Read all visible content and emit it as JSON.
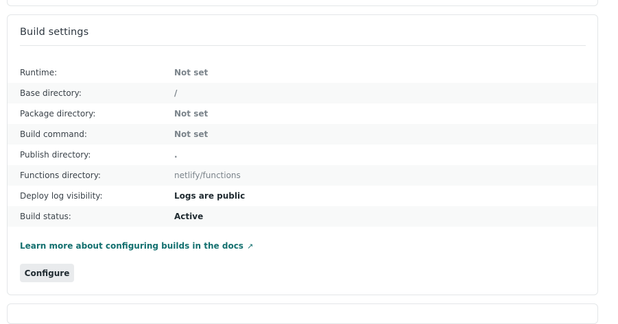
{
  "build_settings": {
    "title": "Build settings",
    "rows": [
      {
        "label": "Runtime:",
        "value": "Not set"
      },
      {
        "label": "Base directory:",
        "value": "/"
      },
      {
        "label": "Package directory:",
        "value": "Not set"
      },
      {
        "label": "Build command:",
        "value": "Not set"
      },
      {
        "label": "Publish directory:",
        "value": "."
      },
      {
        "label": "Functions directory:",
        "value": "netlify/functions"
      },
      {
        "label": "Deploy log visibility:",
        "value": "Logs are public"
      },
      {
        "label": "Build status:",
        "value": "Active"
      }
    ],
    "docs_link": "Learn more about configuring builds in the docs",
    "docs_link_icon": "↗",
    "configure_label": "Configure"
  },
  "colors": {
    "link": "#13706f",
    "button_bg": "#e9ebed",
    "muted_value": "#7b848b",
    "alt_row_bg": "#f8f9f9"
  }
}
